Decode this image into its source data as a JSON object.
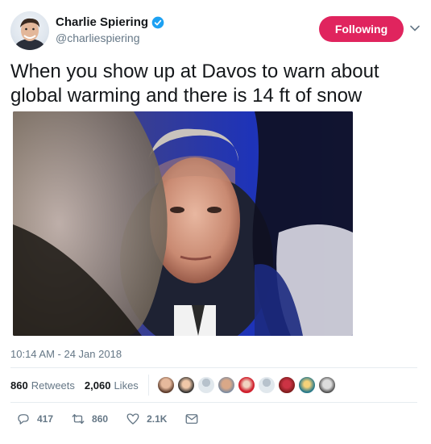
{
  "user": {
    "name": "Charlie Spiering",
    "handle": "@charliespiering",
    "follow_label": "Following"
  },
  "tweet": {
    "text": "When you show up at Davos to warn about global warming and there is 14 ft of snow",
    "timestamp": "10:14 AM - 24 Jan 2018"
  },
  "stats": {
    "retweets_count": "860",
    "retweets_label": "Retweets",
    "likes_count": "2,060",
    "likes_label": "Likes"
  },
  "actions": {
    "reply_count": "417",
    "retweet_count": "860",
    "like_count": "2.1K"
  },
  "colors": {
    "follow_button": "#e0245e",
    "verified": "#1da1f2",
    "secondary_text": "#657786"
  },
  "icons": [
    "verified-badge-icon",
    "chevron-down-icon",
    "reply-icon",
    "retweet-icon",
    "heart-icon",
    "direct-message-icon"
  ]
}
